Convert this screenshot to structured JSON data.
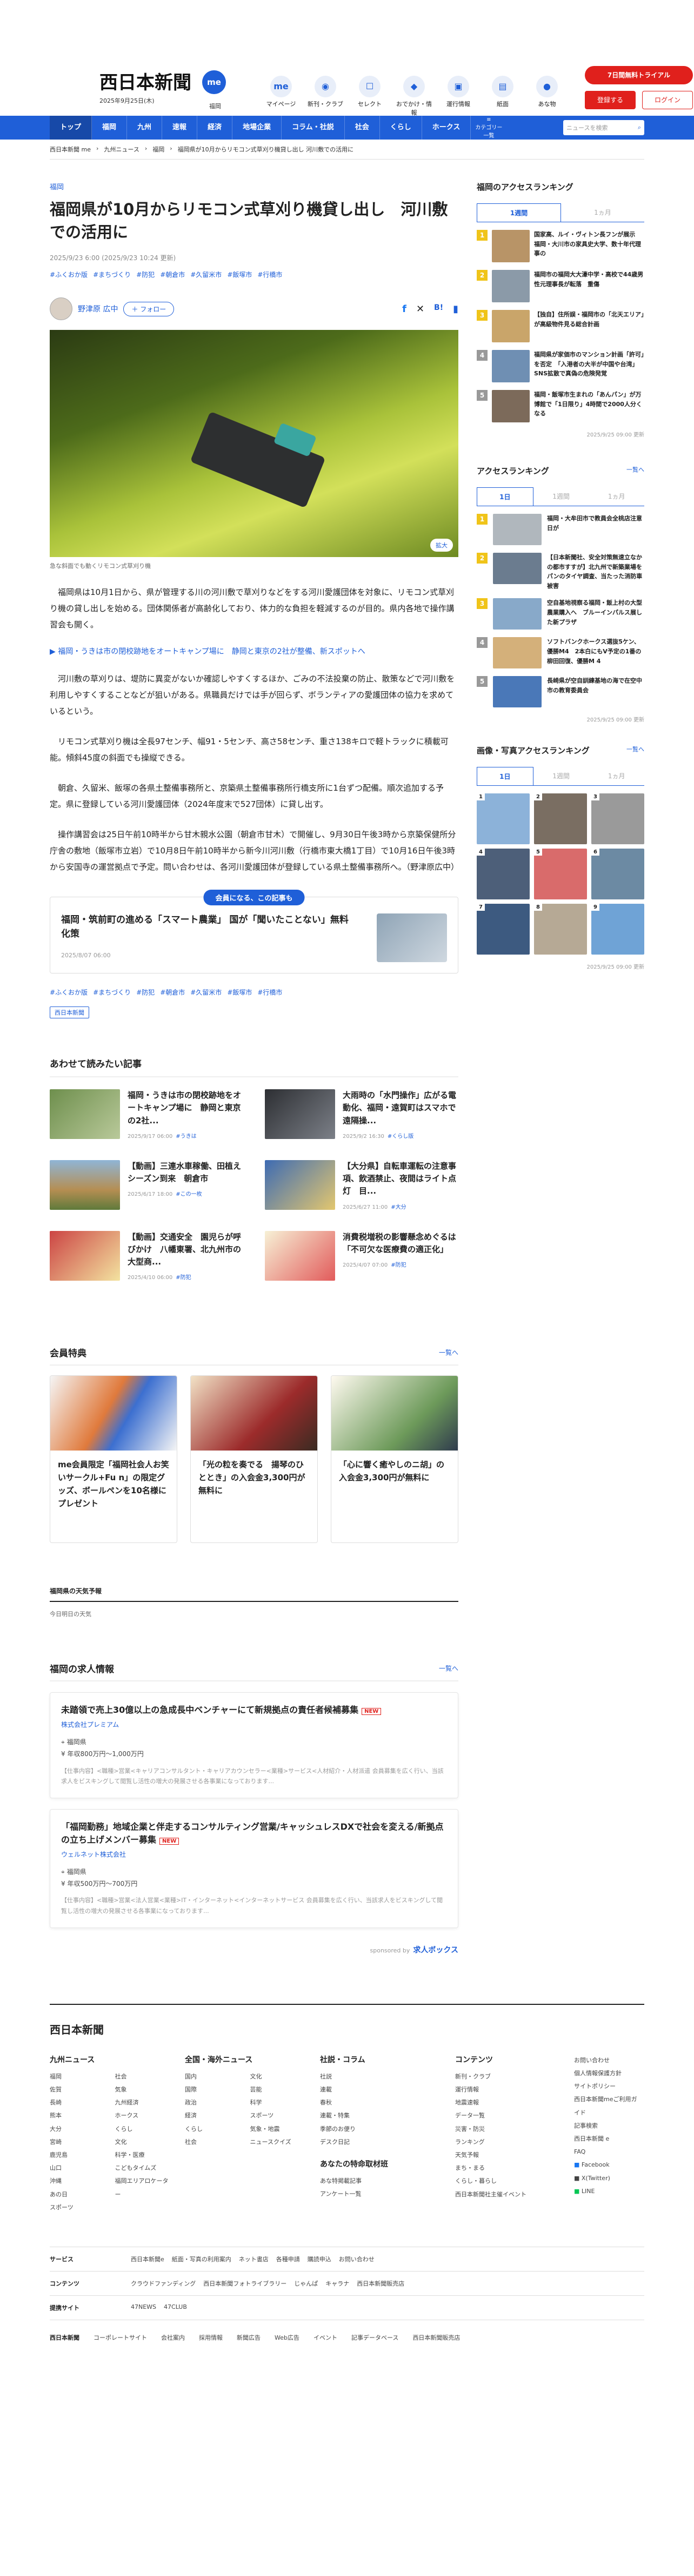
{
  "header": {
    "logo": "西日本新聞",
    "logo_me": "me",
    "date": "2025年9月25日(木)",
    "region": "福岡",
    "icons": [
      {
        "label": "マイページ",
        "icon": "me-icon",
        "glyph": "me"
      },
      {
        "label": "新刊・クラブ",
        "icon": "book-icon",
        "glyph": "◉"
      },
      {
        "label": "セレクト",
        "icon": "select-icon",
        "glyph": "☐"
      },
      {
        "label": "おでかけ・情報",
        "icon": "pin-icon",
        "glyph": "◆"
      },
      {
        "label": "運行情報",
        "icon": "train-icon",
        "glyph": "▣"
      },
      {
        "label": "紙面",
        "icon": "paper-icon",
        "glyph": "▤"
      },
      {
        "label": "あな物",
        "icon": "animal-icon",
        "glyph": "●"
      }
    ],
    "trial": "7日間無料トライアル",
    "register": "登録する",
    "login": "ログイン"
  },
  "nav": {
    "items": [
      "トップ",
      "福岡",
      "九州",
      "速報",
      "経済",
      "地場企業",
      "コラム・社説",
      "社会",
      "くらし",
      "ホークス"
    ],
    "search_placeholder": "ニュースを検索",
    "menu_label": "カテゴリー一覧"
  },
  "breadcrumb": [
    "西日本新聞 me",
    "九州ニュース",
    "福岡",
    "福岡県が10月からリモコン式草刈り機貸し出し 河川敷での活用に"
  ],
  "article": {
    "category": "福岡",
    "title": "福岡県が10月からリモコン式草刈り機貸し出し　河川敷での活用に",
    "meta": "2025/9/23 6:00 (2025/9/23 10:24 更新)",
    "tags": [
      "#ふくおか版",
      "#まちづくり",
      "#防犯",
      "#朝倉市",
      "#久留米市",
      "#飯塚市",
      "#行橋市"
    ],
    "author": "野津原 広中",
    "follow": "＋ フォロー",
    "share_icons": [
      "f",
      "✕",
      "B!",
      "▮"
    ],
    "photo_zoom": "拡大",
    "caption": "急な斜面でも動くリモコン式草刈り機",
    "paragraphs": [
      "福岡県は10月1日から、県が管理する川の河川敷で草刈りなどをする河川愛護団体を対象に、リモコン式草刈り機の貸し出しを始める。団体関係者が高齢化しており、体力的な負担を軽減するのが目的。県内各地で操作講習会も開く。",
      "河川敷の草刈りは、堤防に異変がないか確認しやすくするほか、ごみの不法投棄の防止、散策などで河川敷を利用しやすくすることなどが狙いがある。県職員だけでは手が回らず、ボランティアの愛護団体の協力を求めているという。",
      "リモコン式草刈り機は全長97センチ、幅91・5センチ、高さ58センチ、重さ138キロで軽トラックに積載可能。傾斜45度の斜面でも操縦できる。",
      "朝倉、久留米、飯塚の各県土整備事務所と、京築県土整備事務所行橋支所に1台ずつ配備。順次追加する予定。県に登録している河川愛護団体（2024年度末で527団体）に貸し出す。",
      "操作講習会は25日午前10時半から甘木親水公園（朝倉市甘木）で開催し、9月30日午後3時から京築保健所分庁舎の敷地（飯塚市立岩）で10月8日午前10時半から新今川河川敷（行橋市東大橋1丁目）で10月16日午後3時から安国寺の運営拠点で予定。問い合わせは、各河川愛護団体が登録している県土整備事務所へ。（野津原広中）"
    ],
    "related_link": "福岡・うきは市の閉校跡地をオートキャンプ場に　静岡と東京の2社が整備、新スポットへ",
    "member_badge": "会員になる、この記事も",
    "member_title": "福岡・筑前町の進める「スマート農業」 国が「聞いたことない」無料化策",
    "member_date": "2025/8/07 06:00",
    "bottom_tags": [
      "#ふくおか版",
      "#まちづくり",
      "#防犯",
      "#朝倉市",
      "#久留米市",
      "#飯塚市",
      "#行橋市"
    ],
    "newspaper_label": "西日本新聞"
  },
  "related": {
    "title": "あわせて読みたい記事",
    "items": [
      {
        "title": "福岡・うきは市の閉校跡地をオートキャンプ場に　静岡と東京の2社...",
        "date": "2025/9/17 06:00",
        "tag": "#うきは"
      },
      {
        "title": "大雨時の「水門操作」広がる電動化、福岡・遠賀町はスマホで遠隔操...",
        "date": "2025/9/2 16:30",
        "tag": "#くらし版"
      },
      {
        "title": "【動画】三連水車稼働、田植えシーズン到来　朝倉市",
        "date": "2025/6/17 18:00",
        "tag": "#この一枚"
      },
      {
        "title": "【大分県】自転車運転の注意事項、飲酒禁止、夜間はライト点灯　目...",
        "date": "2025/6/27 11:00",
        "tag": "#大分"
      },
      {
        "title": "【動画】交通安全　園児らが呼びかけ　八幡東署、北九州市の大型商...",
        "date": "2025/4/10 06:00",
        "tag": "#防犯"
      },
      {
        "title": "消費税増税の影響懸念めぐるは「不可欠な医療費の適正化」",
        "date": "2025/4/07 07:00",
        "tag": "#防犯"
      }
    ]
  },
  "benefits": {
    "title": "会員特典",
    "more": "一覧へ",
    "items": [
      "me会員限定「福岡社会人お笑いサークル+Fu n」の限定グッズ、ボールペンを10名様にプレゼント",
      "「光の粒を奏でる　揚琴のひととき」の入会金3,300円が無料に",
      "「心に響く癒やしのニ胡」の入会金3,300円が無料に"
    ]
  },
  "weather": {
    "title": "福岡県の天気予報",
    "sub": "今日明日の天気"
  },
  "jobs": {
    "title": "福岡の求人情報",
    "more": "一覧へ",
    "items": [
      {
        "title": "未踏領で売上30億以上の急成長中ベンチャーにて新規拠点の責任者候補募集",
        "new": "NEW",
        "company": "株式会社プレミアム",
        "location": "福岡県",
        "salary": "年収800万円〜1,000万円",
        "desc": "【仕事内容】<職種>営業<キャリアコンサルタント・キャリアカウンセラー<業種>サービス<人材紹介・人材派遣 会員募集を広く行い、当該求人をビスキングして閲覧し活性の増大の発展させる各事業になっております..."
      },
      {
        "title": "「福岡勤務」地域企業と伴走するコンサルティング営業/キャッシュレスDXで社会を変える/新拠点の立ち上げメンバー募集",
        "new": "NEW",
        "company": "ウェルネット株式会社",
        "location": "福岡県",
        "salary": "年収500万円〜700万円",
        "desc": "【仕事内容】<職種>営業<法人営業<業種>IT・インターネット<インターネットサービス 会員募集を広く行い、当該求人をビスキングして閲覧し活性の増大の発展させる各事業になっております..."
      }
    ],
    "sponsor": "sponsored by",
    "sponsor_name": "求人ボックス"
  },
  "sidebar": {
    "access_rank_title": "福岡のアクセスランキング",
    "rank_tabs": [
      "1週間",
      "1ヵ月"
    ],
    "rank_items": [
      "国家高、ルイ・ヴィトン長フンが展示　福岡・大川市の家具史大学、数十年代理事の",
      "福岡市の福岡大大濠中学・高校で44歳男性元理事長が転落　重傷",
      "【独自】住所誤・福岡市の「北天エリア」が高級物件見る総合計画",
      "福岡県が家価市のマンション計画「許可」を否定　「入港者の大半が中国や台湾」SNS拡散で真偽の危険発覚",
      "福岡・飯塚市生まれの「あんパン」が万博館で「1日限り」4時間で2000人分くなる"
    ],
    "rank_stamp": "2025/9/25 09:00 更新",
    "access_title": "アクセスランキング",
    "access_more": "一覧へ",
    "access_tabs": [
      "1日",
      "1週間",
      "1ヵ月"
    ],
    "access_items": [
      "福岡・大牟田市で教員会全桃店注意日が",
      "【日本新聞社、安全対策無速立なかの都市すすが】北九州で新築業場をパンのタイヤ調査、当たった消防車被害",
      "空自基地視察る福岡・飯上村の大型農業購入へ　ブルーインパルス展した新プラザ",
      "ソフトバンクホークス選抜5ケン、優勝M4　2本白にもV予定の1番の柳田回復、優勝M 4",
      "長崎県が空自訓練基地の海で在空中市の教育委員会"
    ],
    "access_stamp": "2025/9/25 09:00 更新",
    "photo_title": "画像・写真アクセスランキング",
    "photo_more": "一覧へ",
    "photo_tabs": [
      "1日",
      "1週間",
      "1ヵ月"
    ],
    "photo_nums": [
      "1",
      "2",
      "3",
      "4",
      "5",
      "6",
      "7",
      "8",
      "9"
    ],
    "photo_stamp": "2025/9/25 09:00 更新"
  },
  "footer": {
    "logo": "西日本新聞",
    "cols": [
      {
        "title": "九州ニュース",
        "items": [
          "福岡",
          "佐賀",
          "長崎",
          "熊本",
          "大分",
          "宮崎",
          "鹿児島",
          "山口",
          "沖縄",
          "あの日",
          "スポーツ",
          "社会",
          "気象",
          "九州経済",
          "ホークス",
          "くらし",
          "文化",
          "科学・医療",
          "こどもタイムズ",
          "福岡エリアロケーター"
        ]
      },
      {
        "title": "全国・海外ニュース",
        "items": [
          "国内",
          "国際",
          "政治",
          "経済",
          "くらし",
          "社会",
          "文化",
          "芸能",
          "科学",
          "スポーツ",
          "気象・地震",
          "ニュースクイズ"
        ]
      },
      {
        "title": "社説・コラム",
        "items": [
          "社説",
          "連載",
          "春秋",
          "連載・特集",
          "季節のお便り",
          "デスク日記"
        ]
      },
      {
        "title": "コンテンツ",
        "items": [
          "新刊・クラブ",
          "運行情報",
          "地震速報",
          "データ一覧",
          "災害・防災",
          "ランキング",
          "天気予報",
          "まち・まる",
          "くらし・暮らし",
          "西日本新聞社主催イベント"
        ]
      }
    ],
    "side": [
      "お問い合わせ",
      "個人情報保護方針",
      "サイトポリシー",
      "西日本新聞meご利用ガイド",
      "記事検索",
      "西日本新聞 e",
      "FAQ",
      "Facebook",
      "X(Twitter)",
      "LINE"
    ],
    "special": {
      "title": "あなたの特命取材班",
      "items": [
        "あな特掲載記事",
        "アンケート一覧"
      ]
    },
    "rows": [
      {
        "label": "サービス",
        "items": [
          "西日本新聞e",
          "紙面・写真の利用案内",
          "ネット書店",
          "各種申請",
          "購読申込",
          "お問い合わせ"
        ]
      },
      {
        "label": "コンテンツ",
        "items": [
          "クラウドファンディング",
          "西日本新聞フォトライブラリー",
          "じゃんぱ",
          "キャラナ",
          "西日本新聞販売店"
        ]
      },
      {
        "label": "提携サイト",
        "items": [
          "47NEWS",
          "47CLUB"
        ]
      }
    ],
    "bottom": [
      "西日本新聞",
      "コーポレートサイト",
      "会社案内",
      "採用情報",
      "新聞広告",
      "Web広告",
      "イベント",
      "記事データベース",
      "西日本新聞販売店"
    ]
  }
}
